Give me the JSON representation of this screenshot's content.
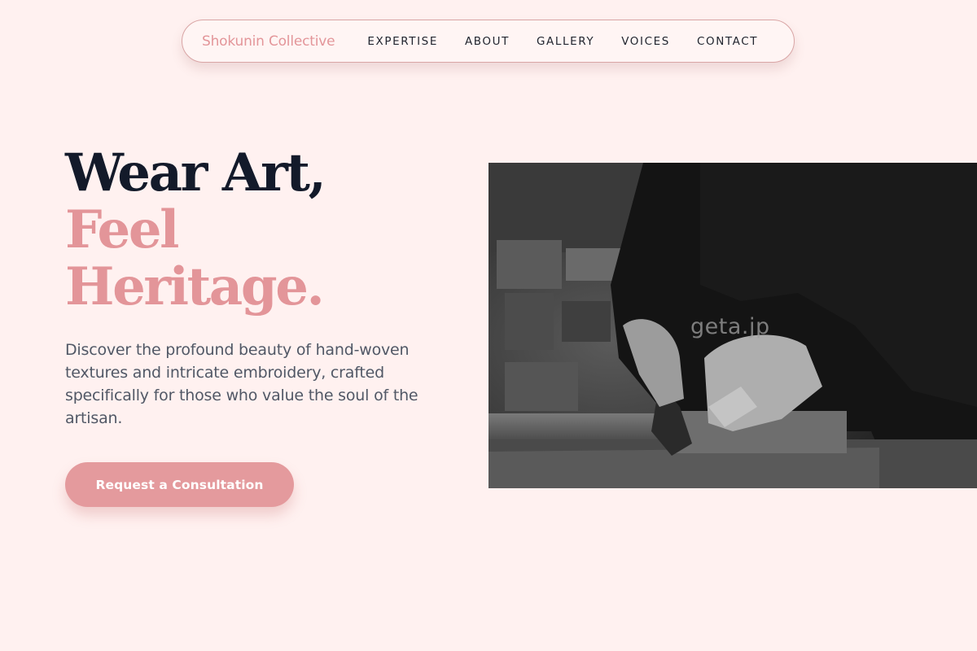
{
  "brand": {
    "name": "Shokunin Collective"
  },
  "nav": {
    "items": [
      {
        "label": "EXPERTISE"
      },
      {
        "label": "ABOUT"
      },
      {
        "label": "GALLERY"
      },
      {
        "label": "VOICES"
      },
      {
        "label": "CONTACT"
      }
    ]
  },
  "hero": {
    "headline_line1": "Wear Art,",
    "headline_line2": "Feel",
    "headline_line3": "Heritage.",
    "description": "Discover the profound beauty of hand-woven textures and intricate embroidery, crafted specifically for those who value the soul of the artisan.",
    "cta_label": "Request a Consultation",
    "image": {
      "subject": "black-and-white photo of an artisan cutting wood with a hand tool at a workbench",
      "watermark": "geta.jp"
    }
  },
  "colors": {
    "background": "#fff1f0",
    "accent": "#e39599",
    "heading": "#131a2a",
    "body_text": "#515866"
  }
}
